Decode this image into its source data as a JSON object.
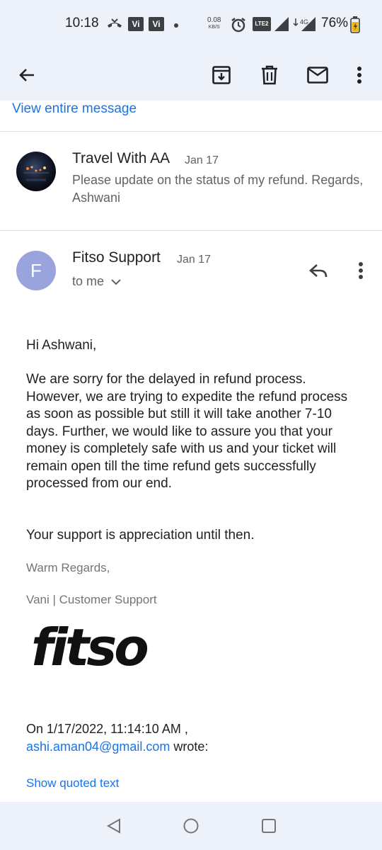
{
  "status_bar": {
    "time": "10:18",
    "carrier1": "Vi",
    "carrier2": "Vi",
    "net_speed_value": "0.08",
    "net_speed_unit": "KB/S",
    "lte_label": "LTE2",
    "network_4g": "4G",
    "battery": "76%",
    "icons": [
      "missed-call-icon",
      "vi-icon",
      "vi-icon",
      "dot-icon",
      "alarm-icon",
      "volte-icon",
      "signal-icon",
      "4g-signal-icon",
      "battery-charging-icon"
    ]
  },
  "toolbar": {
    "icons": [
      "back-arrow-icon",
      "archive-icon",
      "delete-icon",
      "mark-unread-icon",
      "more-vert-icon"
    ]
  },
  "view_entire_message": "View entire message",
  "thread": [
    {
      "sender": "Travel With AA",
      "date": "Jan 17",
      "snippet": "Please update on the status of my refund. Regards, Ashwani"
    },
    {
      "sender": "Fitso Support",
      "date": "Jan 17",
      "avatar_letter": "F",
      "to": "to me",
      "body": {
        "greeting": "Hi Ashwani,",
        "paragraph1": "We are sorry for the delayed in refund process. However, we are trying to expedite the refund process as soon as possible but still it will take another 7-10 days. Further, we would like to assure you that your money is completely safe with us and your ticket will remain open till the time refund gets successfully processed from our end.",
        "paragraph2": "Your support is appreciation until then.",
        "regards": "Warm Regards,",
        "signature": "Vani | Customer Support",
        "logo_text": "fitso",
        "quote_header": "On 1/17/2022, 11:14:10 AM ,",
        "quote_email": "ashi.aman04@gmail.com",
        "quote_wrote": "wrote:",
        "show_quoted": "Show quoted text"
      }
    }
  ],
  "colors": {
    "accent": "#1a73e8",
    "toolbar_bg": "#edf2fa",
    "avatar_f": "#99a3dc"
  }
}
